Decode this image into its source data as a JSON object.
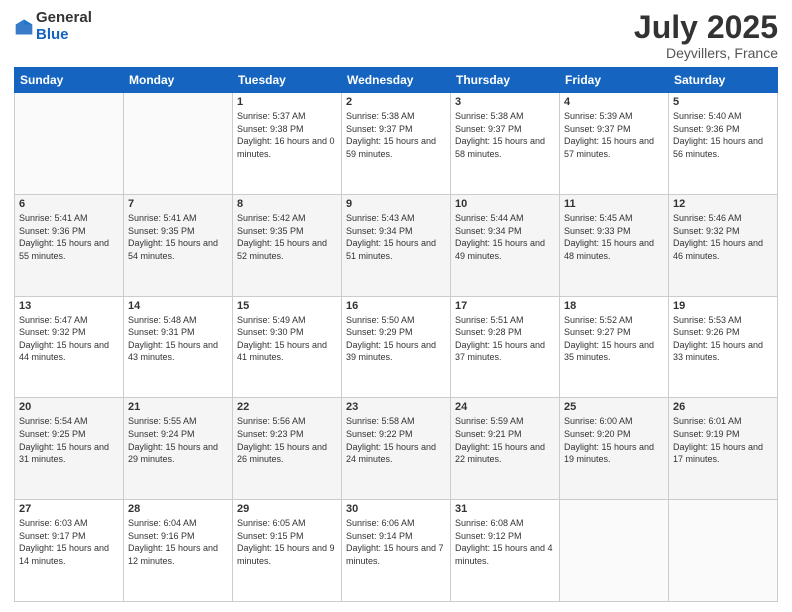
{
  "header": {
    "logo_general": "General",
    "logo_blue": "Blue",
    "month_title": "July 2025",
    "location": "Deyvillers, France"
  },
  "weekdays": [
    "Sunday",
    "Monday",
    "Tuesday",
    "Wednesday",
    "Thursday",
    "Friday",
    "Saturday"
  ],
  "weeks": [
    [
      {
        "day": "",
        "sunrise": "",
        "sunset": "",
        "daylight": ""
      },
      {
        "day": "",
        "sunrise": "",
        "sunset": "",
        "daylight": ""
      },
      {
        "day": "1",
        "sunrise": "Sunrise: 5:37 AM",
        "sunset": "Sunset: 9:38 PM",
        "daylight": "Daylight: 16 hours and 0 minutes."
      },
      {
        "day": "2",
        "sunrise": "Sunrise: 5:38 AM",
        "sunset": "Sunset: 9:37 PM",
        "daylight": "Daylight: 15 hours and 59 minutes."
      },
      {
        "day": "3",
        "sunrise": "Sunrise: 5:38 AM",
        "sunset": "Sunset: 9:37 PM",
        "daylight": "Daylight: 15 hours and 58 minutes."
      },
      {
        "day": "4",
        "sunrise": "Sunrise: 5:39 AM",
        "sunset": "Sunset: 9:37 PM",
        "daylight": "Daylight: 15 hours and 57 minutes."
      },
      {
        "day": "5",
        "sunrise": "Sunrise: 5:40 AM",
        "sunset": "Sunset: 9:36 PM",
        "daylight": "Daylight: 15 hours and 56 minutes."
      }
    ],
    [
      {
        "day": "6",
        "sunrise": "Sunrise: 5:41 AM",
        "sunset": "Sunset: 9:36 PM",
        "daylight": "Daylight: 15 hours and 55 minutes."
      },
      {
        "day": "7",
        "sunrise": "Sunrise: 5:41 AM",
        "sunset": "Sunset: 9:35 PM",
        "daylight": "Daylight: 15 hours and 54 minutes."
      },
      {
        "day": "8",
        "sunrise": "Sunrise: 5:42 AM",
        "sunset": "Sunset: 9:35 PM",
        "daylight": "Daylight: 15 hours and 52 minutes."
      },
      {
        "day": "9",
        "sunrise": "Sunrise: 5:43 AM",
        "sunset": "Sunset: 9:34 PM",
        "daylight": "Daylight: 15 hours and 51 minutes."
      },
      {
        "day": "10",
        "sunrise": "Sunrise: 5:44 AM",
        "sunset": "Sunset: 9:34 PM",
        "daylight": "Daylight: 15 hours and 49 minutes."
      },
      {
        "day": "11",
        "sunrise": "Sunrise: 5:45 AM",
        "sunset": "Sunset: 9:33 PM",
        "daylight": "Daylight: 15 hours and 48 minutes."
      },
      {
        "day": "12",
        "sunrise": "Sunrise: 5:46 AM",
        "sunset": "Sunset: 9:32 PM",
        "daylight": "Daylight: 15 hours and 46 minutes."
      }
    ],
    [
      {
        "day": "13",
        "sunrise": "Sunrise: 5:47 AM",
        "sunset": "Sunset: 9:32 PM",
        "daylight": "Daylight: 15 hours and 44 minutes."
      },
      {
        "day": "14",
        "sunrise": "Sunrise: 5:48 AM",
        "sunset": "Sunset: 9:31 PM",
        "daylight": "Daylight: 15 hours and 43 minutes."
      },
      {
        "day": "15",
        "sunrise": "Sunrise: 5:49 AM",
        "sunset": "Sunset: 9:30 PM",
        "daylight": "Daylight: 15 hours and 41 minutes."
      },
      {
        "day": "16",
        "sunrise": "Sunrise: 5:50 AM",
        "sunset": "Sunset: 9:29 PM",
        "daylight": "Daylight: 15 hours and 39 minutes."
      },
      {
        "day": "17",
        "sunrise": "Sunrise: 5:51 AM",
        "sunset": "Sunset: 9:28 PM",
        "daylight": "Daylight: 15 hours and 37 minutes."
      },
      {
        "day": "18",
        "sunrise": "Sunrise: 5:52 AM",
        "sunset": "Sunset: 9:27 PM",
        "daylight": "Daylight: 15 hours and 35 minutes."
      },
      {
        "day": "19",
        "sunrise": "Sunrise: 5:53 AM",
        "sunset": "Sunset: 9:26 PM",
        "daylight": "Daylight: 15 hours and 33 minutes."
      }
    ],
    [
      {
        "day": "20",
        "sunrise": "Sunrise: 5:54 AM",
        "sunset": "Sunset: 9:25 PM",
        "daylight": "Daylight: 15 hours and 31 minutes."
      },
      {
        "day": "21",
        "sunrise": "Sunrise: 5:55 AM",
        "sunset": "Sunset: 9:24 PM",
        "daylight": "Daylight: 15 hours and 29 minutes."
      },
      {
        "day": "22",
        "sunrise": "Sunrise: 5:56 AM",
        "sunset": "Sunset: 9:23 PM",
        "daylight": "Daylight: 15 hours and 26 minutes."
      },
      {
        "day": "23",
        "sunrise": "Sunrise: 5:58 AM",
        "sunset": "Sunset: 9:22 PM",
        "daylight": "Daylight: 15 hours and 24 minutes."
      },
      {
        "day": "24",
        "sunrise": "Sunrise: 5:59 AM",
        "sunset": "Sunset: 9:21 PM",
        "daylight": "Daylight: 15 hours and 22 minutes."
      },
      {
        "day": "25",
        "sunrise": "Sunrise: 6:00 AM",
        "sunset": "Sunset: 9:20 PM",
        "daylight": "Daylight: 15 hours and 19 minutes."
      },
      {
        "day": "26",
        "sunrise": "Sunrise: 6:01 AM",
        "sunset": "Sunset: 9:19 PM",
        "daylight": "Daylight: 15 hours and 17 minutes."
      }
    ],
    [
      {
        "day": "27",
        "sunrise": "Sunrise: 6:03 AM",
        "sunset": "Sunset: 9:17 PM",
        "daylight": "Daylight: 15 hours and 14 minutes."
      },
      {
        "day": "28",
        "sunrise": "Sunrise: 6:04 AM",
        "sunset": "Sunset: 9:16 PM",
        "daylight": "Daylight: 15 hours and 12 minutes."
      },
      {
        "day": "29",
        "sunrise": "Sunrise: 6:05 AM",
        "sunset": "Sunset: 9:15 PM",
        "daylight": "Daylight: 15 hours and 9 minutes."
      },
      {
        "day": "30",
        "sunrise": "Sunrise: 6:06 AM",
        "sunset": "Sunset: 9:14 PM",
        "daylight": "Daylight: 15 hours and 7 minutes."
      },
      {
        "day": "31",
        "sunrise": "Sunrise: 6:08 AM",
        "sunset": "Sunset: 9:12 PM",
        "daylight": "Daylight: 15 hours and 4 minutes."
      },
      {
        "day": "",
        "sunrise": "",
        "sunset": "",
        "daylight": ""
      },
      {
        "day": "",
        "sunrise": "",
        "sunset": "",
        "daylight": ""
      }
    ]
  ]
}
